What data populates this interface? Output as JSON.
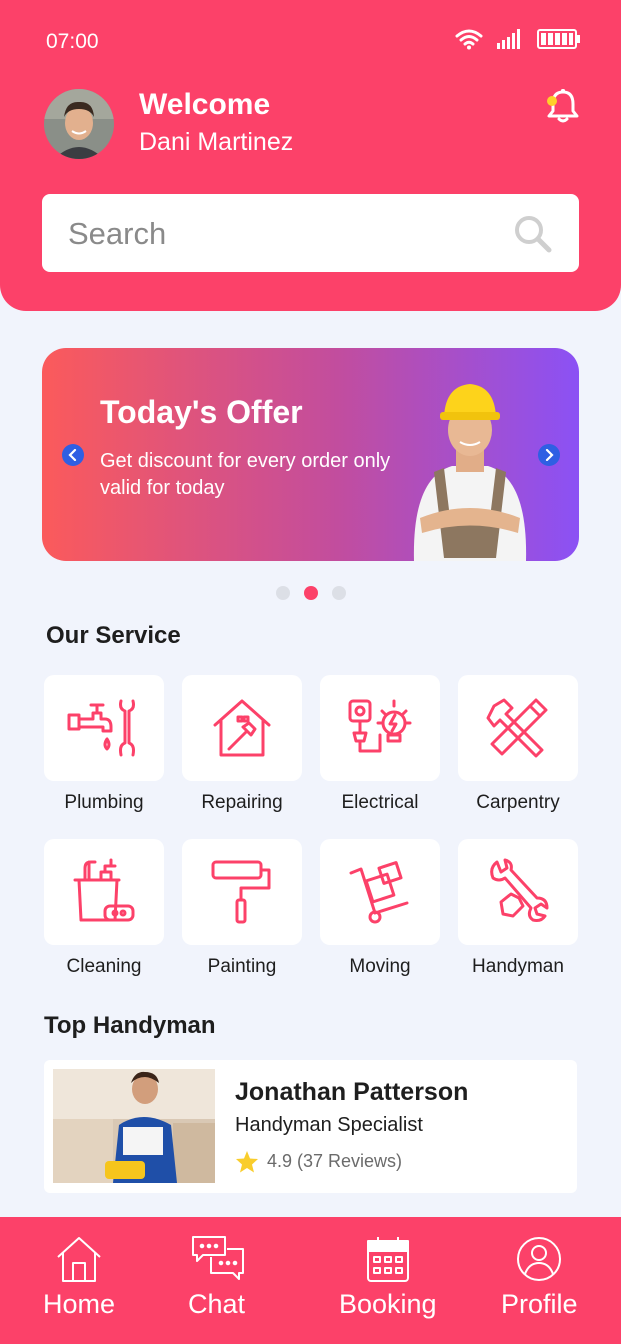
{
  "status": {
    "time": "07:00"
  },
  "header": {
    "greeting": "Welcome",
    "username": "Dani Martinez"
  },
  "search": {
    "placeholder": "Search"
  },
  "offer": {
    "title": "Today's Offer",
    "text": "Get discount for every order only valid for today"
  },
  "carousel": {
    "pages": 3,
    "active_index": 1
  },
  "services": {
    "title": "Our Service",
    "items": [
      {
        "label": "Plumbing",
        "icon": "plumbing-icon"
      },
      {
        "label": "Repairing",
        "icon": "repairing-icon"
      },
      {
        "label": "Electrical",
        "icon": "electrical-icon"
      },
      {
        "label": "Carpentry",
        "icon": "carpentry-icon"
      },
      {
        "label": "Cleaning",
        "icon": "cleaning-icon"
      },
      {
        "label": "Painting",
        "icon": "painting-icon"
      },
      {
        "label": "Moving",
        "icon": "moving-icon"
      },
      {
        "label": "Handyman",
        "icon": "handyman-icon"
      }
    ]
  },
  "top_handyman": {
    "title": "Top Handyman",
    "name": "Jonathan Patterson",
    "role": "Handyman Specialist",
    "rating": "4.9 (37 Reviews)"
  },
  "nav": {
    "items": [
      {
        "label": "Home",
        "icon": "home-icon"
      },
      {
        "label": "Chat",
        "icon": "chat-icon"
      },
      {
        "label": "Booking",
        "icon": "calendar-icon"
      },
      {
        "label": "Profile",
        "icon": "profile-icon"
      }
    ]
  },
  "colors": {
    "primary": "#fc4169",
    "background": "#f1f4fc",
    "gradient_start": "#fb5a5b",
    "gradient_end": "#8b51f5",
    "star": "#f9cd2c"
  }
}
